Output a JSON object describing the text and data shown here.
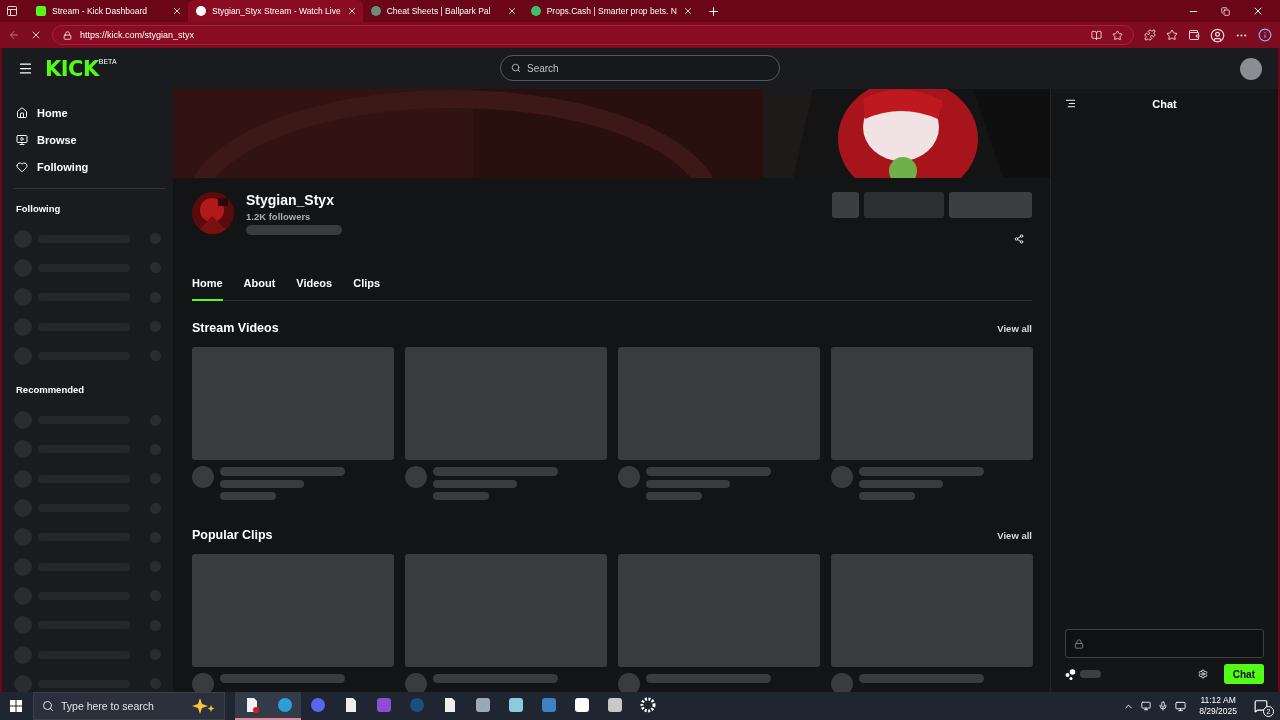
{
  "browser": {
    "tabs": [
      {
        "title": "Stream - Kick Dashboard",
        "kind": "kick",
        "selected": false
      },
      {
        "title": "Stygian_Styx Stream - Watch Live",
        "kind": "stream",
        "selected": true
      },
      {
        "title": "Cheat Sheets | Ballpark Pal",
        "kind": "pal",
        "selected": false
      },
      {
        "title": "Props.Cash | Smarter prop bets. N",
        "kind": "props",
        "selected": false
      }
    ],
    "url": "https://kick.com/stygian_styx",
    "loading": true
  },
  "header": {
    "logo": "KICK",
    "logo_badge": "BETA",
    "search": {
      "placeholder": "Search"
    }
  },
  "sidebar": {
    "nav": [
      {
        "label": "Home",
        "kind": "home"
      },
      {
        "label": "Browse",
        "kind": "browse"
      },
      {
        "label": "Following",
        "kind": "heart"
      }
    ],
    "sections": [
      {
        "title": "Following",
        "rows": [
          {
            "kind": "skeleton"
          },
          {
            "kind": "skeleton"
          },
          {
            "kind": "skeleton"
          },
          {
            "kind": "skeleton"
          },
          {
            "kind": "skeleton"
          }
        ]
      },
      {
        "title": "Recommended",
        "rows": [
          {
            "kind": "skeleton"
          },
          {
            "kind": "skeleton"
          },
          {
            "kind": "skeleton"
          },
          {
            "kind": "skeleton"
          },
          {
            "kind": "skeleton"
          },
          {
            "kind": "skeleton"
          },
          {
            "kind": "skeleton"
          },
          {
            "kind": "skeleton"
          },
          {
            "kind": "skeleton"
          },
          {
            "kind": "skeleton"
          }
        ]
      }
    ]
  },
  "channel": {
    "name": "Stygian_Styx",
    "followers": "1.2K followers",
    "tabs": [
      {
        "label": "Home",
        "selected": true
      },
      {
        "label": "About",
        "selected": false
      },
      {
        "label": "Videos",
        "selected": false
      },
      {
        "label": "Clips",
        "selected": false
      }
    ],
    "sections": [
      {
        "title": "Stream Videos",
        "link": "View all",
        "cards": [
          {
            "kind": "skeleton"
          },
          {
            "kind": "skeleton"
          },
          {
            "kind": "skeleton"
          },
          {
            "kind": "skeleton"
          }
        ]
      },
      {
        "title": "Popular Clips",
        "link": "View all",
        "cards": [
          {
            "kind": "skeleton-cut"
          },
          {
            "kind": "skeleton-cut"
          },
          {
            "kind": "skeleton-cut"
          },
          {
            "kind": "skeleton-cut"
          }
        ]
      }
    ]
  },
  "chat": {
    "title": "Chat",
    "input": {
      "disabled": true
    },
    "send": "Chat"
  },
  "taskbar": {
    "search": {
      "placeholder": "Type here to search"
    },
    "apps": [
      {
        "kind": "doc-record",
        "active": true
      },
      {
        "kind": "edge",
        "active": true
      },
      {
        "kind": "discord",
        "active": false
      },
      {
        "kind": "file",
        "active": false
      },
      {
        "kind": "video",
        "active": false
      },
      {
        "kind": "steam",
        "active": false
      },
      {
        "kind": "file",
        "active": false
      },
      {
        "kind": "photos",
        "active": false
      },
      {
        "kind": "notepad",
        "active": false
      },
      {
        "kind": "cleaner",
        "active": false
      },
      {
        "kind": "capcut",
        "active": false
      },
      {
        "kind": "gallery",
        "active": false
      },
      {
        "kind": "settings",
        "active": false
      }
    ],
    "time": "11:12 AM",
    "date": "8/29/2025",
    "notifications": "2"
  }
}
